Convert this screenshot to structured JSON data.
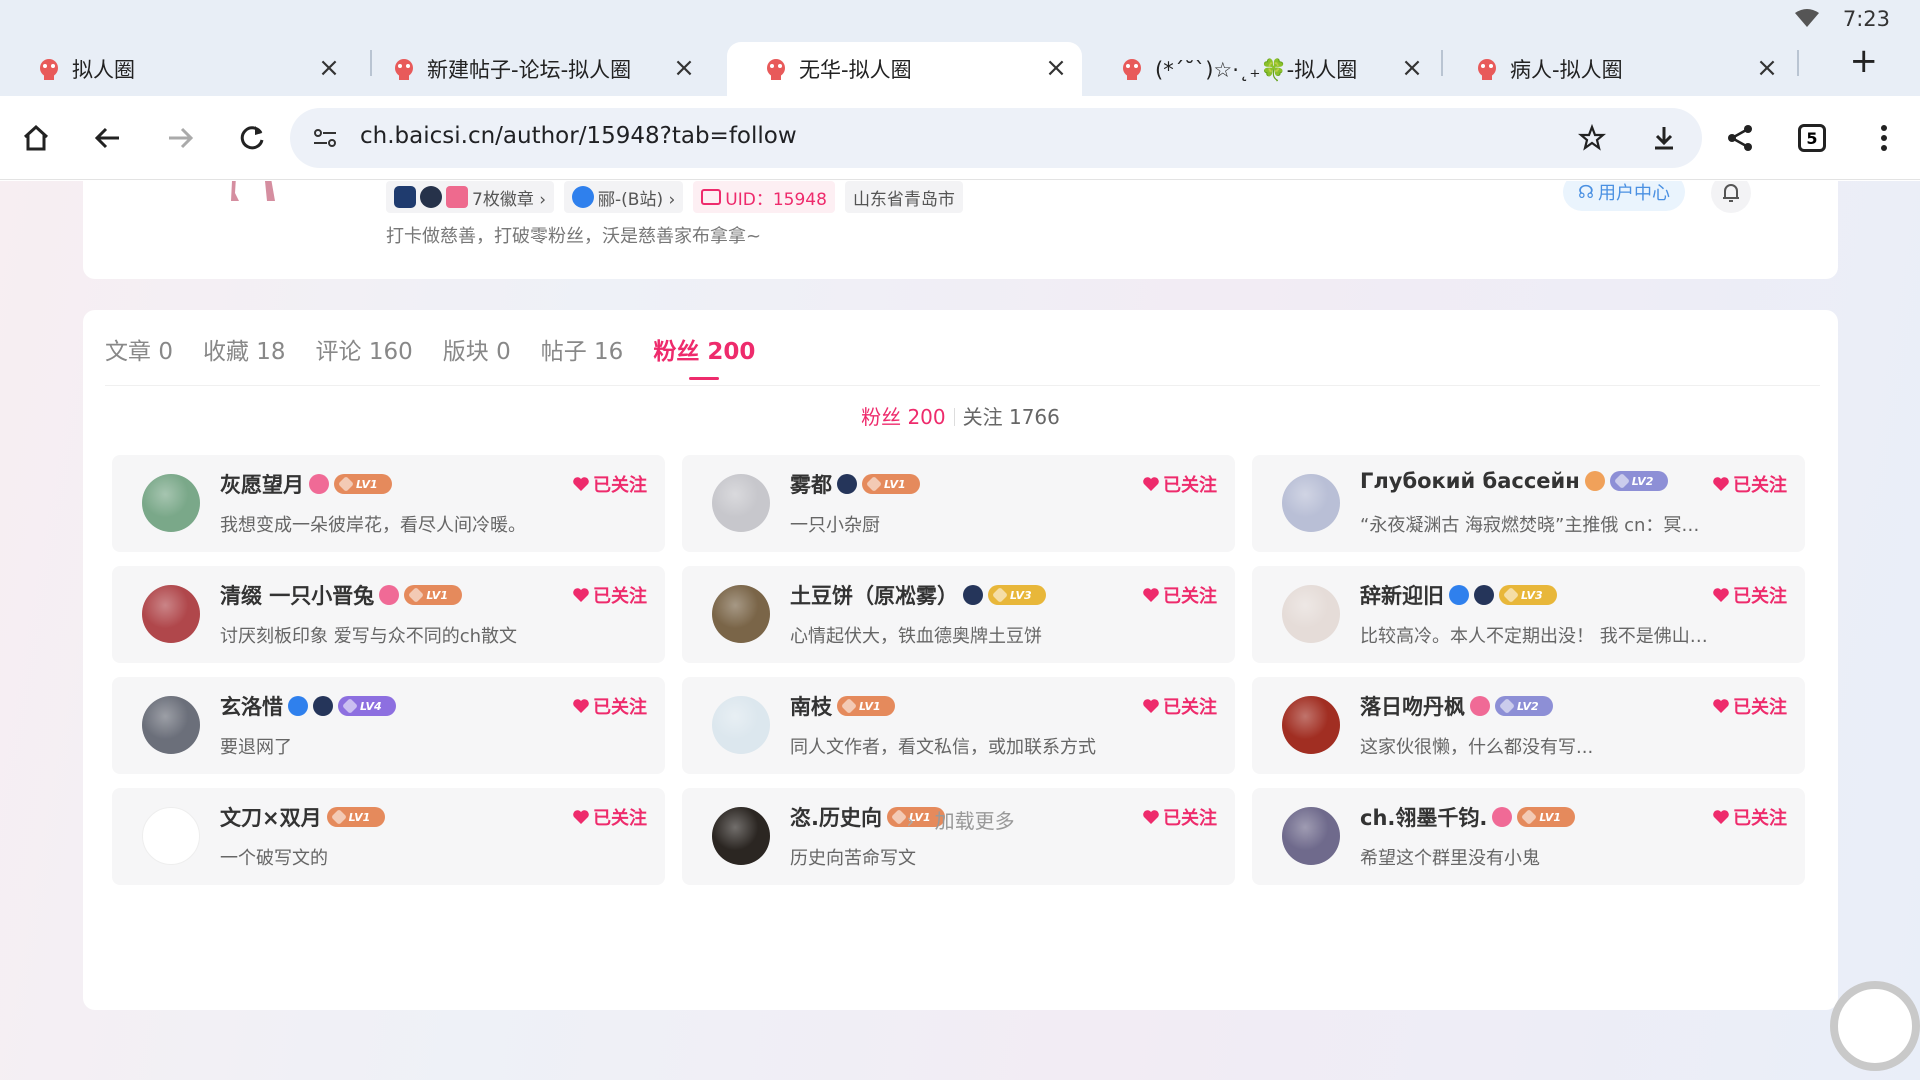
{
  "status": {
    "time": "7:23"
  },
  "tabs": [
    {
      "title": "拟人圈",
      "active": false
    },
    {
      "title": "新建帖子-论坛-拟人圈",
      "active": false
    },
    {
      "title": "无华-拟人圈",
      "active": true
    },
    {
      "title": "(*´˘`)☆·˛₊🍀-拟人圈",
      "active": false
    },
    {
      "title": "病人-拟人圈",
      "active": false
    }
  ],
  "toolbar": {
    "url": "ch.baicsi.cn/author/15948?tab=follow",
    "tab_count": "5"
  },
  "profile": {
    "badges_label": "7枚徽章 ›",
    "bilibili_label": "郦-(B站) ›",
    "uid_label": "UID：15948",
    "location": "山东省青岛市",
    "bio": "打卡做慈善，打破零粉丝，沃是慈善家布拿拿~",
    "user_center": "用户中心"
  },
  "content_tabs": [
    {
      "label": "文章",
      "count": "0"
    },
    {
      "label": "收藏",
      "count": "18"
    },
    {
      "label": "评论",
      "count": "160"
    },
    {
      "label": "版块",
      "count": "0"
    },
    {
      "label": "帖子",
      "count": "16"
    },
    {
      "label": "粉丝",
      "count": "200"
    }
  ],
  "subtabs": {
    "fans": "粉丝 200",
    "following": "关注 1766"
  },
  "follow_label": "已关注",
  "users": [
    {
      "name": "灰愿望月",
      "level": "LV1",
      "level_color": "#e58a5c",
      "sig": "我想变成一朵彼岸花，看尽人间冷暖。",
      "avatar_color": "#7aa889",
      "extra": "pink"
    },
    {
      "name": "雾都",
      "level": "LV1",
      "level_color": "#e58a5c",
      "sig": "一只小杂厨",
      "avatar_color": "#c7c7cc",
      "extra": "navy"
    },
    {
      "name": "Глубокий бассейн",
      "level": "LV2",
      "level_color": "#8d8fd6",
      "sig": "“永夜凝渊古 海寂燃焚晓”主推俄 cn：冥渊 废人一...",
      "avatar_color": "#b9bfd6",
      "extra": "orange"
    },
    {
      "name": "清缀 一只小晋兔",
      "level": "LV1",
      "level_color": "#e58a5c",
      "sig": "讨厌刻板印象 爱写与众不同的ch散文",
      "avatar_color": "#b0474b",
      "extra": "pink"
    },
    {
      "name": "土豆饼（原凇雾）",
      "level": "LV3",
      "level_color": "#e8b73a",
      "sig": "心情起伏大，铁血德奥牌土豆饼",
      "avatar_color": "#7a6548",
      "extra": "navy"
    },
    {
      "name": "辞新迎旧",
      "level": "LV3",
      "level_color": "#e8b73a",
      "sig": "比较高冷。本人不定期出没！ 我不是佛山人呀!",
      "avatar_color": "#e5dcd8",
      "extra": "blue-navy"
    },
    {
      "name": "玄洛惜",
      "level": "LV4",
      "level_color": "#8d6fe0",
      "sig": "要退网了",
      "avatar_color": "#6b6f7a",
      "extra": "blue-navy"
    },
    {
      "name": "南枝",
      "level": "LV1",
      "level_color": "#e58a5c",
      "sig": "同人文作者，看文私信，或加联系方式",
      "avatar_color": "#dce7ee",
      "extra": ""
    },
    {
      "name": "落日吻丹枫",
      "level": "LV2",
      "level_color": "#8d8fd6",
      "sig": "这家伙很懒，什么都没有写...",
      "avatar_color": "#a12e22",
      "extra": "pink"
    },
    {
      "name": "文刀×双月",
      "level": "LV1",
      "level_color": "#e58a5c",
      "sig": "一个破写文的",
      "avatar_color": "#ffffff",
      "extra": ""
    },
    {
      "name": "恣.历史向",
      "level": "LV1",
      "level_color": "#e58a5c",
      "sig": "历史向苦命写文",
      "avatar_color": "#2b2622",
      "extra": ""
    },
    {
      "name": "ch.翎墨千钧.",
      "level": "LV1",
      "level_color": "#e58a5c",
      "sig": "希望这个群里没有小鬼",
      "avatar_color": "#6f6a8c",
      "extra": "pink"
    }
  ],
  "load_more": "加载更多",
  "colors": {
    "accent": "#ee2b6c",
    "link_blue": "#4a90e2"
  }
}
